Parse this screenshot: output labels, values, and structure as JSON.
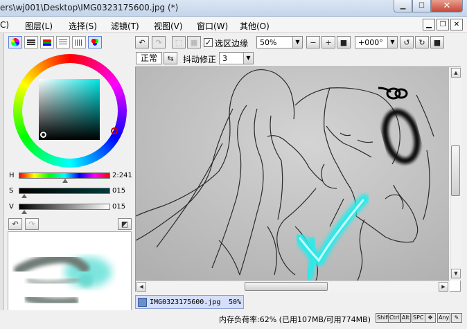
{
  "window": {
    "title": "ers\\wj001\\Desktop\\IMG0323175600.jpg (*)",
    "minimize_icon": "minimize-icon",
    "maximize_icon": "maximize-icon",
    "close_icon": "close-icon"
  },
  "menu": {
    "items": [
      "C)",
      "图层(L)",
      "选择(S)",
      "滤镜(T)",
      "视图(V)",
      "窗口(W)",
      "其他(O)"
    ]
  },
  "toolbar": {
    "selection_edge_label": "选区边缘",
    "selection_edge_checked": true,
    "zoom_value": "50%",
    "rotation_value": "+000°",
    "blend_mode": "正常",
    "stabilizer_label": "抖动修正",
    "stabilizer_value": "3"
  },
  "color_panel": {
    "h_label": "H",
    "h_value": "2:241",
    "s_label": "S",
    "s_value": "015",
    "v_label": "V",
    "v_value": "015",
    "h_level": 0.51,
    "s_level": 0.06,
    "v_level": 0.06,
    "accent": "#00e5e5"
  },
  "document": {
    "tab_name": "IMG0323175600.jpg",
    "tab_zoom": "50%"
  },
  "status": {
    "memory_text": "内存负荷率:62% (已用107MB/可用774MB)",
    "keys": [
      "Shift",
      "Ctrl",
      "Alt",
      "SPC"
    ],
    "any_label": "Any"
  }
}
